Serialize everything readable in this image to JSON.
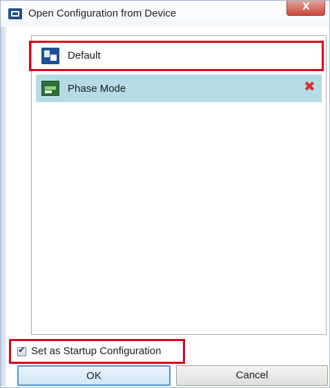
{
  "window": {
    "title": "Open Configuration from Device",
    "close_glyph": "X"
  },
  "list": {
    "items": [
      {
        "label": "Default",
        "icon": "configuration-icon",
        "selected": false
      },
      {
        "label": "Phase Mode",
        "icon": "phase-mode-icon",
        "selected": true,
        "delete_icon": "delete-icon",
        "delete_glyph": "✖"
      }
    ]
  },
  "options": {
    "startup_label": "Set as Startup Configuration",
    "startup_checked": true,
    "check_glyph": "✔"
  },
  "buttons": {
    "ok_label": "OK",
    "cancel_label": "Cancel"
  },
  "colors": {
    "selection": "#b5dce4",
    "highlight_border": "#d9001b",
    "ok_border": "#4b94d0"
  }
}
